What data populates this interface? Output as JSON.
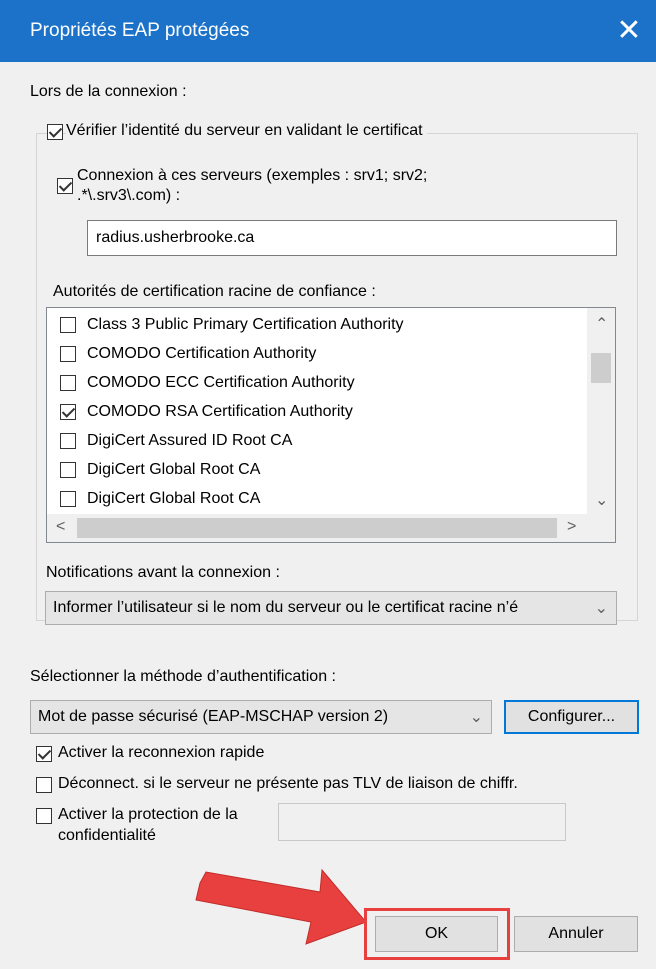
{
  "window": {
    "title": "Propriétés EAP protégées",
    "close_glyph": "✕"
  },
  "connection": {
    "heading": "Lors de la connexion :",
    "verify_server_label": "Vérifier l’identité du serveur en validant le certificat",
    "verify_server_checked": true,
    "connect_servers_label_line1": "Connexion à ces serveurs (exemples : srv1; srv2;",
    "connect_servers_label_line2": ".*\\.srv3\\.com) :",
    "connect_servers_checked": true,
    "servers_value": "radius.usherbrooke.ca",
    "trusted_roots_heading": "Autorités de certification racine de confiance :",
    "trusted_roots": [
      {
        "label": "Class 3 Public Primary Certification Authority",
        "checked": false
      },
      {
        "label": "COMODO Certification Authority",
        "checked": false
      },
      {
        "label": "COMODO ECC Certification Authority",
        "checked": false
      },
      {
        "label": "COMODO RSA Certification Authority",
        "checked": true
      },
      {
        "label": "DigiCert Assured ID Root CA",
        "checked": false
      },
      {
        "label": "DigiCert Global Root CA",
        "checked": false
      },
      {
        "label": "DigiCert Global Root CA",
        "checked": false
      }
    ],
    "notifications_heading": "Notifications avant la connexion :",
    "notifications_value": "Informer l’utilisateur si le nom du serveur ou le certificat racine n’é"
  },
  "auth": {
    "heading": "Sélectionner la méthode d’authentification :",
    "method_value": "Mot de passe sécurisé (EAP-MSCHAP version 2)",
    "configure_label": "Configurer...",
    "fast_reconnect_label": "Activer la reconnexion rapide",
    "fast_reconnect_checked": true,
    "disconnect_tlv_label": "Déconnect. si le serveur ne présente pas TLV de liaison de chiffr.",
    "disconnect_tlv_checked": false,
    "privacy_label_line1": "Activer la protection de la",
    "privacy_label_line2": "confidentialité",
    "privacy_checked": false,
    "privacy_value": ""
  },
  "buttons": {
    "ok_label": "OK",
    "cancel_label": "Annuler"
  },
  "colors": {
    "titlebar": "#1b72c8",
    "highlight_box": "#e8403e",
    "arrow": "#e8403e"
  }
}
